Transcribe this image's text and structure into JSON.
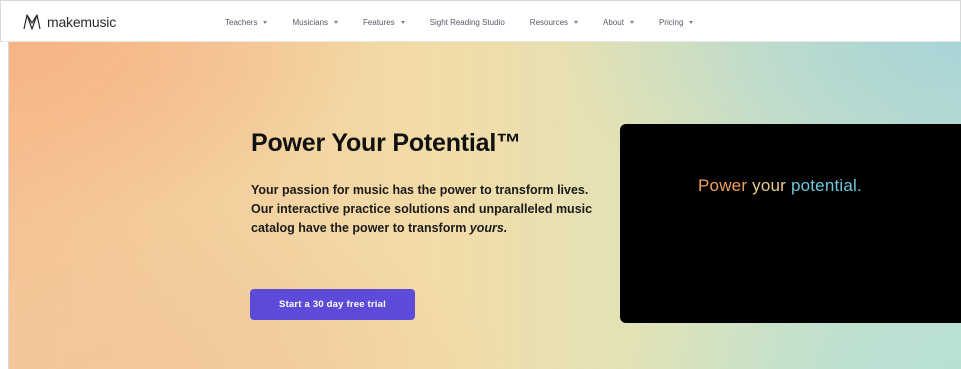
{
  "brand": {
    "name": "makemusic",
    "logo_icon": "makemusic-logo-icon",
    "accent_color": "#5b4bd8"
  },
  "nav": {
    "items": [
      {
        "label": "Teachers",
        "has_dropdown": true
      },
      {
        "label": "Musicians",
        "has_dropdown": true
      },
      {
        "label": "Features",
        "has_dropdown": true
      },
      {
        "label": "Sight Reading Studio",
        "has_dropdown": false
      },
      {
        "label": "Resources",
        "has_dropdown": true
      },
      {
        "label": "About",
        "has_dropdown": true
      },
      {
        "label": "Pricing",
        "has_dropdown": true
      }
    ]
  },
  "hero": {
    "title": "Power Your Potential™",
    "body_text": "Your passion for music has the power to transform lives. Our interactive practice solutions and unparalleled music catalog have the power to transform ",
    "body_emphasis": "yours.",
    "cta_label": "Start a 30 day free trial"
  },
  "video": {
    "tagline_word1": "Power",
    "tagline_word2": "your",
    "tagline_word3": "potential.",
    "colors": {
      "word1": "#f3a05c",
      "word2": "#e9c98c",
      "word3": "#6fc6d8",
      "background": "#000000"
    }
  }
}
